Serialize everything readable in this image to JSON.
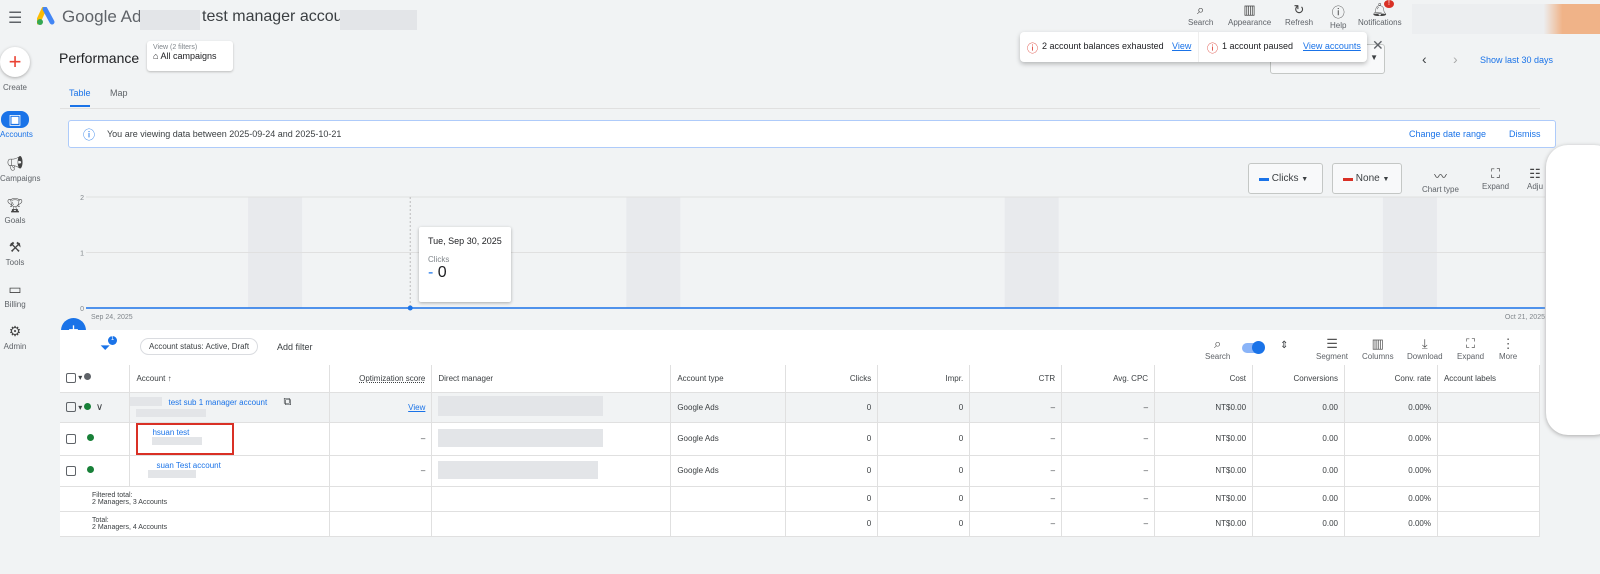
{
  "header": {
    "product": "Google Ads",
    "account_title": "test manager account",
    "icons": [
      {
        "label": "Search",
        "icon": "search-icon"
      },
      {
        "label": "Appearance",
        "icon": "appearance-icon"
      },
      {
        "label": "Refresh",
        "icon": "refresh-icon"
      },
      {
        "label": "Help",
        "icon": "help-icon"
      },
      {
        "label": "Notifications",
        "icon": "bell-icon"
      }
    ],
    "notification_badge": "!"
  },
  "sidebar": {
    "create": "Create",
    "items": [
      {
        "label": "Accounts"
      },
      {
        "label": "Campaigns"
      },
      {
        "label": "Goals"
      },
      {
        "label": "Tools"
      },
      {
        "label": "Billing"
      },
      {
        "label": "Admin"
      }
    ]
  },
  "page": {
    "title": "Performance",
    "view_label": "View (2 filters)",
    "view_value": "All campaigns",
    "tabs": [
      "Table",
      "Map"
    ],
    "show_last": "Show last 30 days"
  },
  "alerts": {
    "a1": "2 account balances exhausted",
    "a1_link": "View",
    "a2": "1 account paused",
    "a2_link": "View accounts"
  },
  "info": {
    "text": "You are viewing data between 2025-09-24 and 2025-10-21",
    "change": "Change date range",
    "dismiss": "Dismiss"
  },
  "chart_controls": {
    "metric1": "Clicks",
    "metric2": "None",
    "chart_type": "Chart type",
    "expand": "Expand",
    "adjust": "Adju"
  },
  "chart_data": {
    "type": "line",
    "series": [
      {
        "name": "Clicks",
        "color": "#1a73e8",
        "values": [
          0,
          0,
          0,
          0,
          0,
          0,
          0,
          0,
          0,
          0,
          0,
          0,
          0,
          0,
          0,
          0,
          0,
          0,
          0,
          0,
          0,
          0,
          0,
          0,
          0,
          0,
          0,
          0
        ]
      }
    ],
    "x_start": "Sep 24, 2025",
    "x_end": "Oct 21, 2025",
    "y_ticks": [
      "0",
      "1",
      "2"
    ],
    "ylim": [
      0,
      2
    ],
    "tooltip": {
      "date": "Tue, Sep 30, 2025",
      "metric": "Clicks",
      "value": "0"
    }
  },
  "filters": {
    "count": "1",
    "chip": "Account status: Active, Draft",
    "add": "Add filter"
  },
  "toolbar": {
    "search": "Search",
    "segment": "Segment",
    "columns": "Columns",
    "download": "Download",
    "expand": "Expand",
    "more": "More"
  },
  "table": {
    "headers": [
      "Account",
      "Optimization score",
      "Direct manager",
      "Account type",
      "Clicks",
      "Impr.",
      "CTR",
      "Avg. CPC",
      "Cost",
      "Conversions",
      "Conv. rate",
      "Account labels"
    ],
    "rows": [
      {
        "name": "test sub 1 manager account",
        "opt": "View",
        "type": "Google Ads",
        "clicks": "0",
        "impr": "0",
        "ctr": "–",
        "cpc": "–",
        "cost": "NT$0.00",
        "conv": "0.00",
        "rate": "0.00%"
      },
      {
        "name": "hsuan test",
        "opt": "–",
        "type": "Google Ads",
        "clicks": "0",
        "impr": "0",
        "ctr": "–",
        "cpc": "–",
        "cost": "NT$0.00",
        "conv": "0.00",
        "rate": "0.00%"
      },
      {
        "name": "suan Test account",
        "opt": "–",
        "type": "Google Ads",
        "clicks": "0",
        "impr": "0",
        "ctr": "–",
        "cpc": "–",
        "cost": "NT$0.00",
        "conv": "0.00",
        "rate": "0.00%"
      }
    ],
    "totals": [
      {
        "l1": "Filtered total:",
        "l2": "2 Managers, 3 Accounts",
        "clicks": "0",
        "impr": "0",
        "ctr": "–",
        "cpc": "–",
        "cost": "NT$0.00",
        "conv": "0.00",
        "rate": "0.00%"
      },
      {
        "l1": "Total:",
        "l2": "2 Managers, 4 Accounts",
        "clicks": "0",
        "impr": "0",
        "ctr": "–",
        "cpc": "–",
        "cost": "NT$0.00",
        "conv": "0.00",
        "rate": "0.00%"
      }
    ]
  }
}
